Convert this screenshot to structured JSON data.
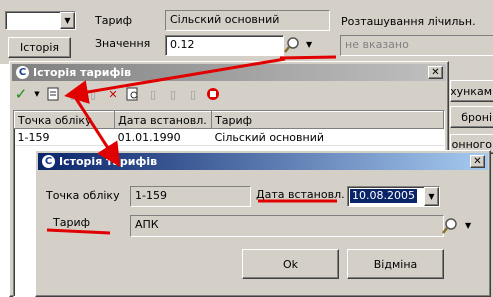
{
  "main": {
    "history_button": "Історія",
    "tariff_label": "Тариф",
    "tariff_value": "Сільский основний",
    "value_label": "Значення",
    "value_value": "0.12",
    "meter_location_label": "Розташування лічильн.",
    "meter_location_value": "не вказано",
    "right_btn_1": "хункам",
    "right_btn_2": "броні",
    "right_btn_3": "зонного"
  },
  "history_window": {
    "title": "Історія тарифів",
    "columns": [
      "Точка обліку",
      "Дата встановл.",
      "Тариф"
    ],
    "rows": [
      [
        "1-159",
        "01.01.1990",
        "Сільский основний"
      ]
    ]
  },
  "edit_dialog": {
    "title": "Історія тарифів",
    "point_label": "Точка обліку",
    "point_value": "1-159",
    "date_label": "Дата встановл.",
    "date_value": "10.08.2005",
    "tariff_label": "Тариф",
    "tariff_value": "АПК",
    "ok_button": "Ok",
    "cancel_button": "Відміна"
  },
  "icons": {
    "app": "app-logo-icon",
    "close": "close-icon",
    "search": "magnifier-icon",
    "dropdown": "chevron-down-icon"
  },
  "colors": {
    "title_active_start": "#0a246a",
    "title_active_end": "#a6caf0",
    "title_inactive": "#808080",
    "annotation": "#e00000",
    "date_highlight": "#0a246a"
  }
}
